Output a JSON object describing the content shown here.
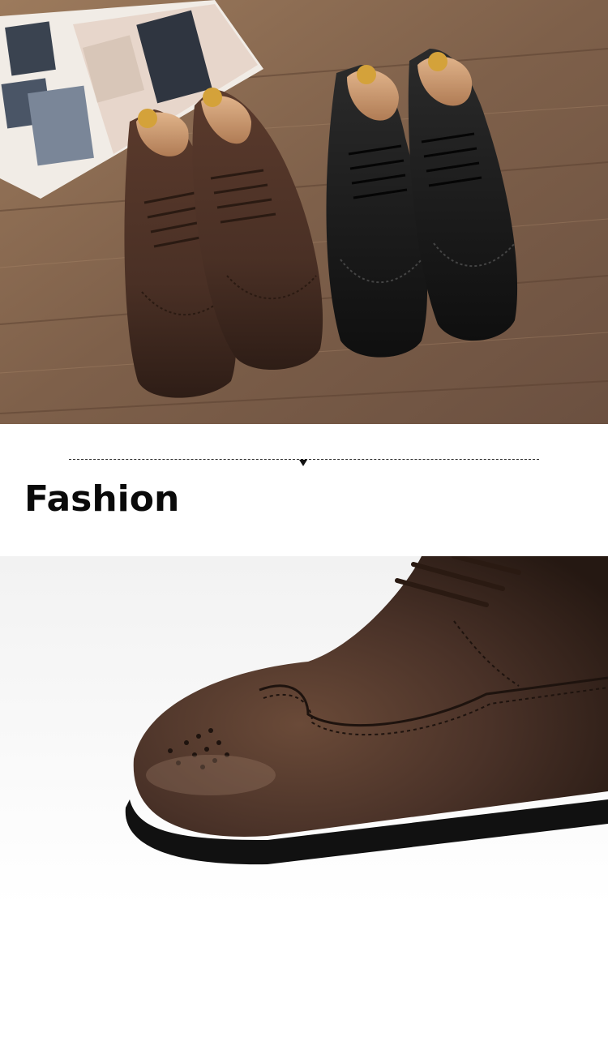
{
  "section": {
    "heading": "Fashion"
  },
  "images": {
    "top_photo": "four-oxford-brogue-shoes-on-wooden-floor",
    "bottom_photo": "closeup-brown-brogue-toe"
  },
  "colors": {
    "wood": "#8a6a4f",
    "brown_leather": "#4a3025",
    "black_leather": "#1a1a1a",
    "shoe_tree": "#c9946a",
    "heading_text": "#0a0a0a"
  }
}
